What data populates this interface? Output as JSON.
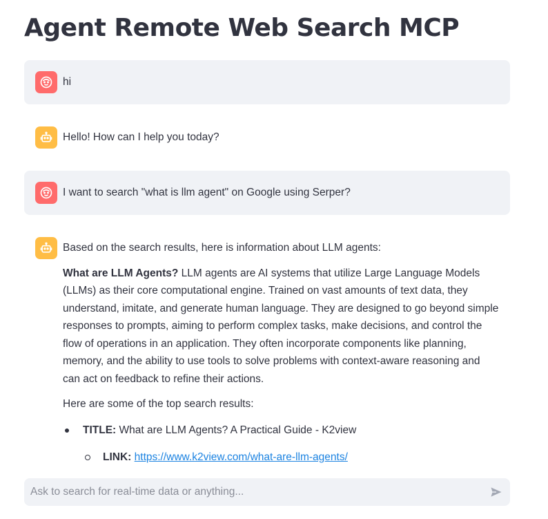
{
  "app": {
    "title": "Agent Remote Web Search MCP"
  },
  "colors": {
    "user_avatar": "#ff6b6b",
    "assistant_avatar": "#ffbd45",
    "user_bubble": "#f0f2f6",
    "link": "#1c83e1"
  },
  "messages": [
    {
      "role": "user",
      "avatar_icon": "face-icon",
      "text": "hi"
    },
    {
      "role": "assistant",
      "avatar_icon": "robot-icon",
      "text": "Hello! How can I help you today?"
    },
    {
      "role": "user",
      "avatar_icon": "face-icon",
      "text": "I want to search \"what is llm agent\" on Google using Serper?"
    },
    {
      "role": "assistant",
      "avatar_icon": "robot-icon",
      "intro": "Based on the search results, here is information about LLM agents:",
      "definition_label": "What are LLM Agents?",
      "definition_text": " LLM agents are AI systems that utilize Large Language Models (LLMs) as their core computational engine. Trained on vast amounts of text data, they understand, imitate, and generate human language. They are designed to go beyond simple responses to prompts, aiming to perform complex tasks, make decisions, and control the flow of operations in an application. They often incorporate components like planning, memory, and the ability to use tools to solve problems with context-aware reasoning and can act on feedback to refine their actions.",
      "results_intro": "Here are some of the top search results:",
      "results": [
        {
          "title_label": "TITLE:",
          "title": " What are LLM Agents? A Practical Guide - K2view",
          "link_label": "LINK:",
          "link": "https://www.k2view.com/what-are-llm-agents/"
        }
      ]
    }
  ],
  "chat_input": {
    "placeholder": "Ask to search for real-time data or anything...",
    "value": "",
    "send_icon": "send-icon"
  }
}
